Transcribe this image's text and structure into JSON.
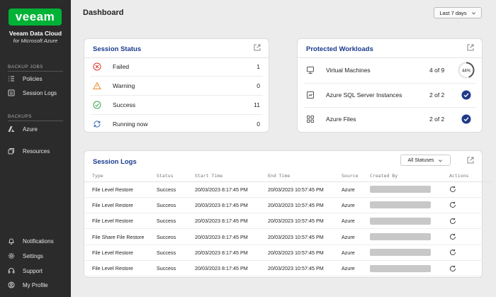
{
  "brand": {
    "logo_text": "veeam",
    "line1": "Veeam Data Cloud",
    "line2": "for Microsoft Azure",
    "accent_color": "#00b336"
  },
  "sidebar": {
    "backup_jobs_heading": "BACKUP JOBS",
    "backups_heading": "BACKUPS",
    "items": [
      {
        "label": "Policies",
        "icon": "policies-icon"
      },
      {
        "label": "Session Logs",
        "icon": "session-logs-icon"
      },
      {
        "label": "Azure",
        "icon": "azure-icon"
      },
      {
        "label": "Resources",
        "icon": "resources-icon"
      }
    ],
    "bottom_items": [
      {
        "label": "Notifications",
        "icon": "bell-icon"
      },
      {
        "label": "Settings",
        "icon": "gear-icon"
      },
      {
        "label": "Support",
        "icon": "headset-icon"
      },
      {
        "label": "My Profile",
        "icon": "user-icon"
      }
    ]
  },
  "header": {
    "title": "Dashboard",
    "range_value": "Last 7 days"
  },
  "session_status": {
    "title": "Session Status",
    "rows": [
      {
        "label": "Failed",
        "value": "1",
        "icon": "failed-icon",
        "color": "#d9342b"
      },
      {
        "label": "Warning",
        "value": "0",
        "icon": "warning-icon",
        "color": "#e8892b"
      },
      {
        "label": "Success",
        "value": "11",
        "icon": "success-icon",
        "color": "#3aa34a"
      },
      {
        "label": "Running now",
        "value": "0",
        "icon": "running-icon",
        "color": "#2d5fb5"
      }
    ]
  },
  "protected_workloads": {
    "title": "Protected Workloads",
    "rows": [
      {
        "label": "Virtual Machines",
        "value": "4 of 9",
        "state": "progress",
        "percent_label": "44%",
        "fraction": 0.44
      },
      {
        "label": "Azure SQL Server Instances",
        "value": "2 of 2",
        "state": "complete"
      },
      {
        "label": "Azure Files",
        "value": "2 of 2",
        "state": "complete"
      }
    ],
    "check_color": "#1f3a8a"
  },
  "session_logs": {
    "title": "Session Logs",
    "filter_value": "All Statuses",
    "columns": [
      "Type",
      "Status",
      "Start Time",
      "End Time",
      "Source",
      "Created By",
      "Actions"
    ],
    "rows": [
      {
        "type": "File Level Restore",
        "status": "Success",
        "start": "20/03/2023 8:17:45 PM",
        "end": "20/03/2023 10:57:45 PM",
        "source": "Azure"
      },
      {
        "type": "File Level Restore",
        "status": "Success",
        "start": "20/03/2023 8:17:45 PM",
        "end": "20/03/2023 10:57:45 PM",
        "source": "Azure"
      },
      {
        "type": "File Level Restore",
        "status": "Success",
        "start": "20/03/2023 8:17:45 PM",
        "end": "20/03/2023 10:57:45 PM",
        "source": "Azure"
      },
      {
        "type": "File Share File Restore",
        "status": "Success",
        "start": "20/03/2023 8:17:45 PM",
        "end": "20/03/2023 10:57:45 PM",
        "source": "Azure"
      },
      {
        "type": "File Level Restore",
        "status": "Success",
        "start": "20/03/2023 8:17:45 PM",
        "end": "20/03/2023 10:57:45 PM",
        "source": "Azure"
      },
      {
        "type": "File Level Restore",
        "status": "Success",
        "start": "20/03/2023 8:17:45 PM",
        "end": "20/03/2023 10:57:45 PM",
        "source": "Azure"
      }
    ]
  }
}
